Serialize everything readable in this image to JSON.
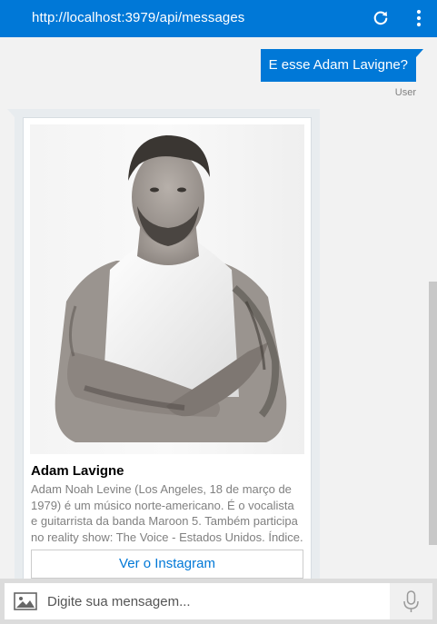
{
  "window": {
    "url": "http://localhost:3979/api/messages"
  },
  "icons": {
    "refresh": "refresh-icon",
    "menu": "more-vertical-icon",
    "image_upload": "image-icon",
    "microphone": "microphone-icon"
  },
  "colors": {
    "accent": "#0078d7",
    "bot_bubble": "#e8ecef",
    "composer_bg": "#dcdcdc"
  },
  "conversation": {
    "user_message": {
      "text": "E esse Adam Lavigne?",
      "sender": "User"
    },
    "bot_card": {
      "title": "Adam Lavigne",
      "description": "Adam Noah Levine (Los Angeles, 18 de março de 1979) é um músico norte-americano. É o vocalista e guitarrista da banda Maroon 5. Também participa no reality show: The Voice - Estados Unidos. Índice.",
      "button_label": "Ver o Instagram"
    }
  },
  "composer": {
    "placeholder": "Digite sua mensagem...",
    "value": ""
  }
}
